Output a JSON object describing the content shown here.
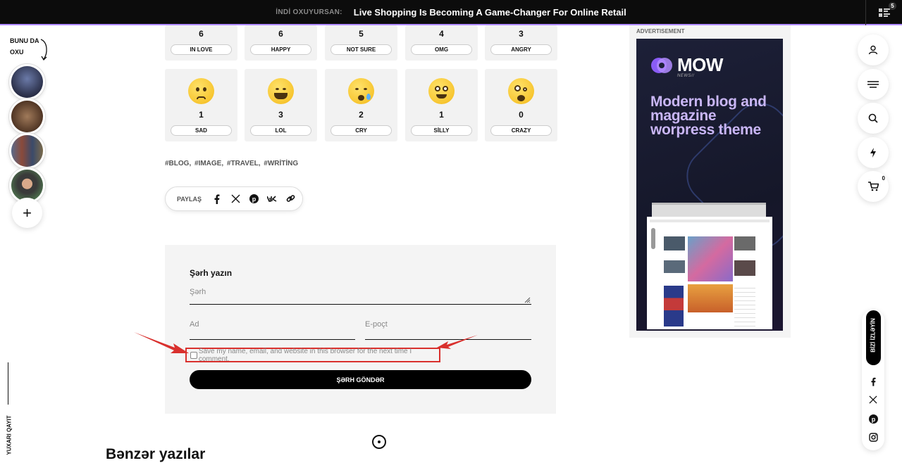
{
  "topbar": {
    "now_reading_label": "İNDİ OXUYURSAN:",
    "headline": "Live Shopping Is Becoming A Game-Changer For Online Retail",
    "list_badge": "5"
  },
  "left_rail": {
    "read_also": "BUNU DA OXU",
    "add_story": "+",
    "back_to_top": "YUXARI QAYIT"
  },
  "reactions_row1": [
    {
      "count": "6",
      "label": "IN LOVE"
    },
    {
      "count": "6",
      "label": "HAPPY"
    },
    {
      "count": "5",
      "label": "NOT SURE"
    },
    {
      "count": "4",
      "label": "OMG"
    },
    {
      "count": "3",
      "label": "ANGRY"
    }
  ],
  "reactions_row2": [
    {
      "count": "1",
      "label": "SAD",
      "icon": "sad-emoji-icon"
    },
    {
      "count": "3",
      "label": "LOL",
      "icon": "lol-emoji-icon"
    },
    {
      "count": "2",
      "label": "CRY",
      "icon": "cry-emoji-icon"
    },
    {
      "count": "1",
      "label": "SİLLY",
      "icon": "silly-emoji-icon"
    },
    {
      "count": "0",
      "label": "CRAZY",
      "icon": "crazy-emoji-icon"
    }
  ],
  "tags": "#BLOG, #IMAGE, #TRAVEL, #WRİTİNG",
  "share": {
    "label": "PAYLAŞ",
    "icons": [
      "facebook-icon",
      "x-icon",
      "pinterest-icon",
      "vk-icon",
      "link-icon"
    ]
  },
  "comment_form": {
    "title": "Şərh yazın",
    "comment_placeholder": "Şərh",
    "name_placeholder": "Ad",
    "email_placeholder": "E-poçt",
    "save_label": "Save my name, email, and website in this browser for the next time I comment.",
    "submit_label": "ŞƏRH GÖNDƏR"
  },
  "similar_posts_title": "Bənzər yazılar",
  "ad": {
    "label": "ADVERTISEMENT",
    "brand": "MOW",
    "brand_sub": "NEWS//",
    "headline": "Modern blog and magazine worpress theme"
  },
  "right_rail": {
    "cart_count": "0",
    "follow_label": "BİZİ İZLƏYİN"
  },
  "colors": {
    "accent": "#b28cff",
    "annotation": "#d9302d",
    "dark": "#000000"
  }
}
